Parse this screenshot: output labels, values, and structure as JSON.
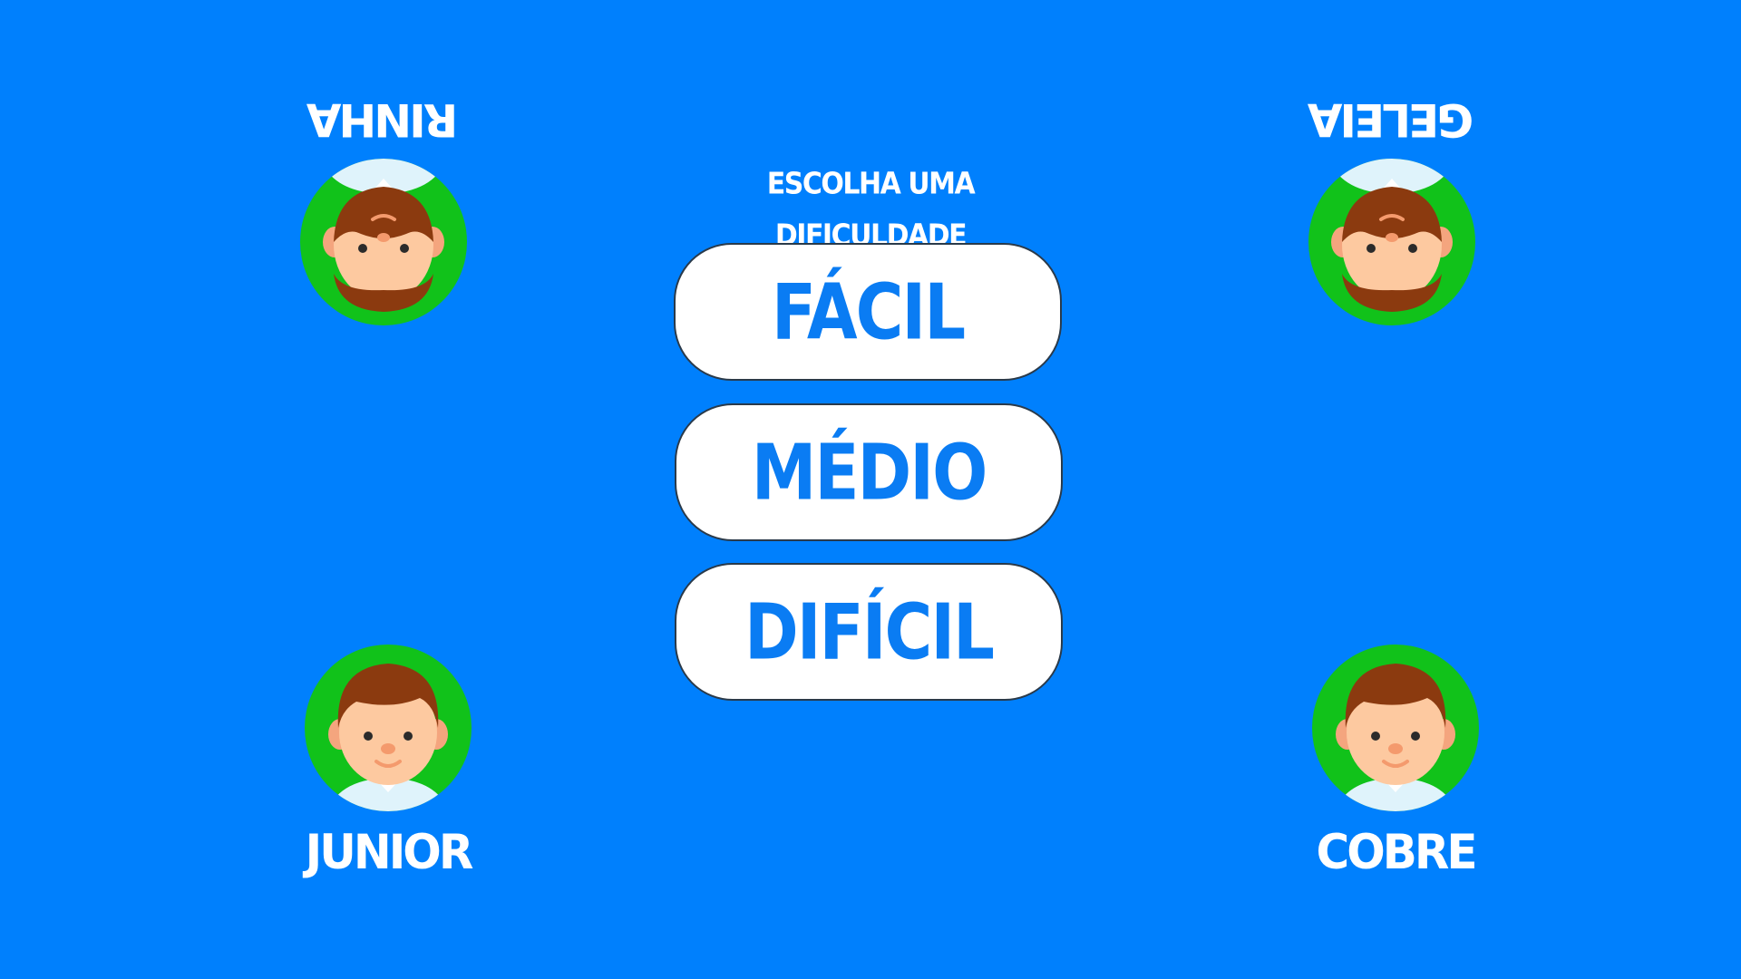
{
  "screen": {
    "background_color": "#0080FD",
    "title": "ESCOLHA UMA DIFICULDADE"
  },
  "difficulty_buttons": [
    {
      "label": "FÁCIL"
    },
    {
      "label": "MÉDIO"
    },
    {
      "label": "DIFÍCIL"
    }
  ],
  "players": [
    {
      "name": "RINHA",
      "position": "top-left",
      "orientation": "upside-down",
      "avatar": "bearded-man-avatar"
    },
    {
      "name": "GELEIA",
      "position": "top-right",
      "orientation": "upside-down",
      "avatar": "bearded-man-avatar"
    },
    {
      "name": "JUNIOR",
      "position": "bottom-left",
      "orientation": "upright",
      "avatar": "boy-avatar"
    },
    {
      "name": "COBRE",
      "position": "bottom-right",
      "orientation": "upright",
      "avatar": "boy-avatar"
    }
  ],
  "colors": {
    "avatar_ring": "#11C21A",
    "button_text": "#0A7CF3",
    "button_background": "#FFFFFF",
    "skin": "#FDC9A0",
    "hair_beard": "#8B3A0F",
    "shirt": "#DFF3FB"
  }
}
